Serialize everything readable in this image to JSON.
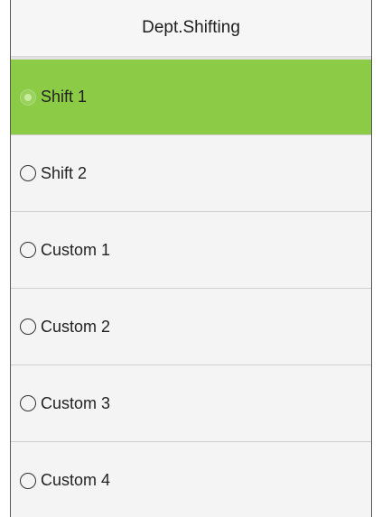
{
  "header": {
    "title": "Dept.Shifting"
  },
  "options": [
    {
      "label": "Shift 1",
      "selected": true
    },
    {
      "label": "Shift 2",
      "selected": false
    },
    {
      "label": "Custom 1",
      "selected": false
    },
    {
      "label": "Custom 2",
      "selected": false
    },
    {
      "label": "Custom 3",
      "selected": false
    },
    {
      "label": "Custom 4",
      "selected": false
    }
  ],
  "colors": {
    "selected_background": "#8ccb45",
    "background": "#f4f4f4",
    "text": "#222222"
  },
  "icons": {
    "selected": "radio-selected-icon",
    "unselected": "radio-unselected-icon"
  }
}
